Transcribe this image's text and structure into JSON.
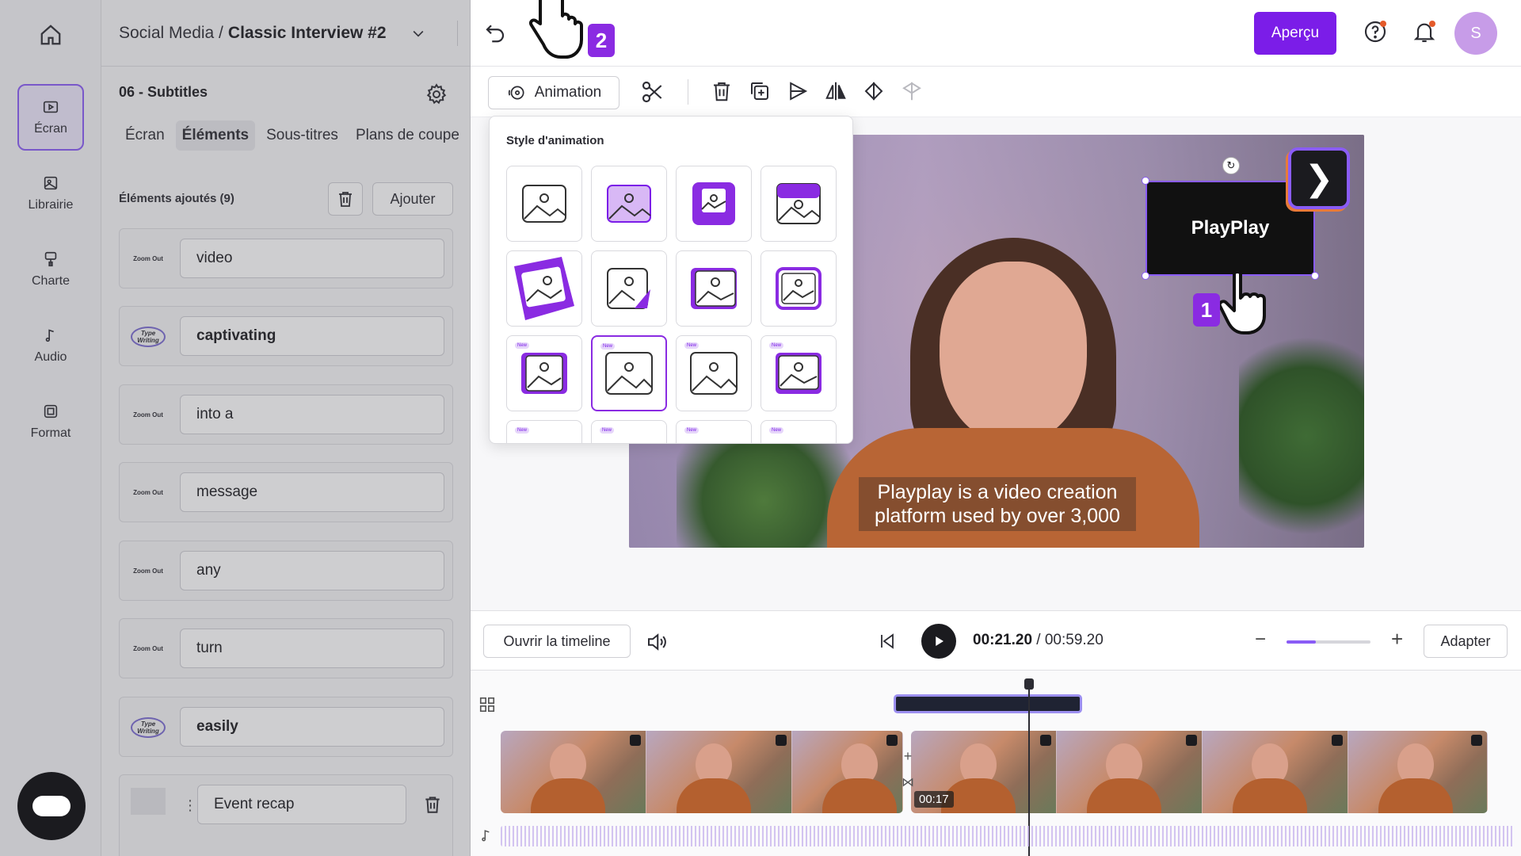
{
  "header": {
    "breadcrumb_prefix": "Social Media /",
    "project_title": "Classic Interview #2",
    "preview_button": "Aperçu",
    "avatar_initial": "S"
  },
  "nav": {
    "items": [
      {
        "label": "Écran",
        "icon": "screen-icon"
      },
      {
        "label": "Librairie",
        "icon": "library-icon"
      },
      {
        "label": "Charte",
        "icon": "brand-icon"
      },
      {
        "label": "Audio",
        "icon": "music-note-icon"
      },
      {
        "label": "Format",
        "icon": "format-icon"
      }
    ]
  },
  "panel": {
    "section_title": "06 - Subtitles",
    "tabs": [
      "Écran",
      "Éléments",
      "Sous-titres",
      "Plans de coupe"
    ],
    "selected_tab": "Éléments",
    "added_label": "Éléments ajoutés (9)",
    "add_button": "Ajouter",
    "elements": [
      {
        "type": "Zoom Out",
        "text": "video"
      },
      {
        "type": "Type Writing",
        "text": "captivating"
      },
      {
        "type": "Zoom Out",
        "text": "into a"
      },
      {
        "type": "Zoom Out",
        "text": "message"
      },
      {
        "type": "Zoom Out",
        "text": "any"
      },
      {
        "type": "Zoom Out",
        "text": "turn"
      },
      {
        "type": "Type Writing",
        "text": "easily"
      },
      {
        "type": "Text",
        "text": "Event recap"
      }
    ]
  },
  "toolbar": {
    "animation_button": "Animation"
  },
  "popover": {
    "title": "Style d'animation",
    "new_badge": "New"
  },
  "canvas": {
    "subtitle_line1": "Playplay is a video creation",
    "subtitle_line2": "platform used by over 3,000",
    "logo_text": "PlayPlay"
  },
  "annotations": {
    "step1": "1",
    "step2": "2"
  },
  "player": {
    "open_timeline": "Ouvrir la timeline",
    "current_time": "00:21.20",
    "total_time": "/ 00:59.20",
    "adapt_button": "Adapter",
    "zoom_level": 0.35
  },
  "timeline": {
    "clip_timestamp": "00:17"
  },
  "colors": {
    "accent": "#7b1de8",
    "selection": "#8a5cf6"
  }
}
